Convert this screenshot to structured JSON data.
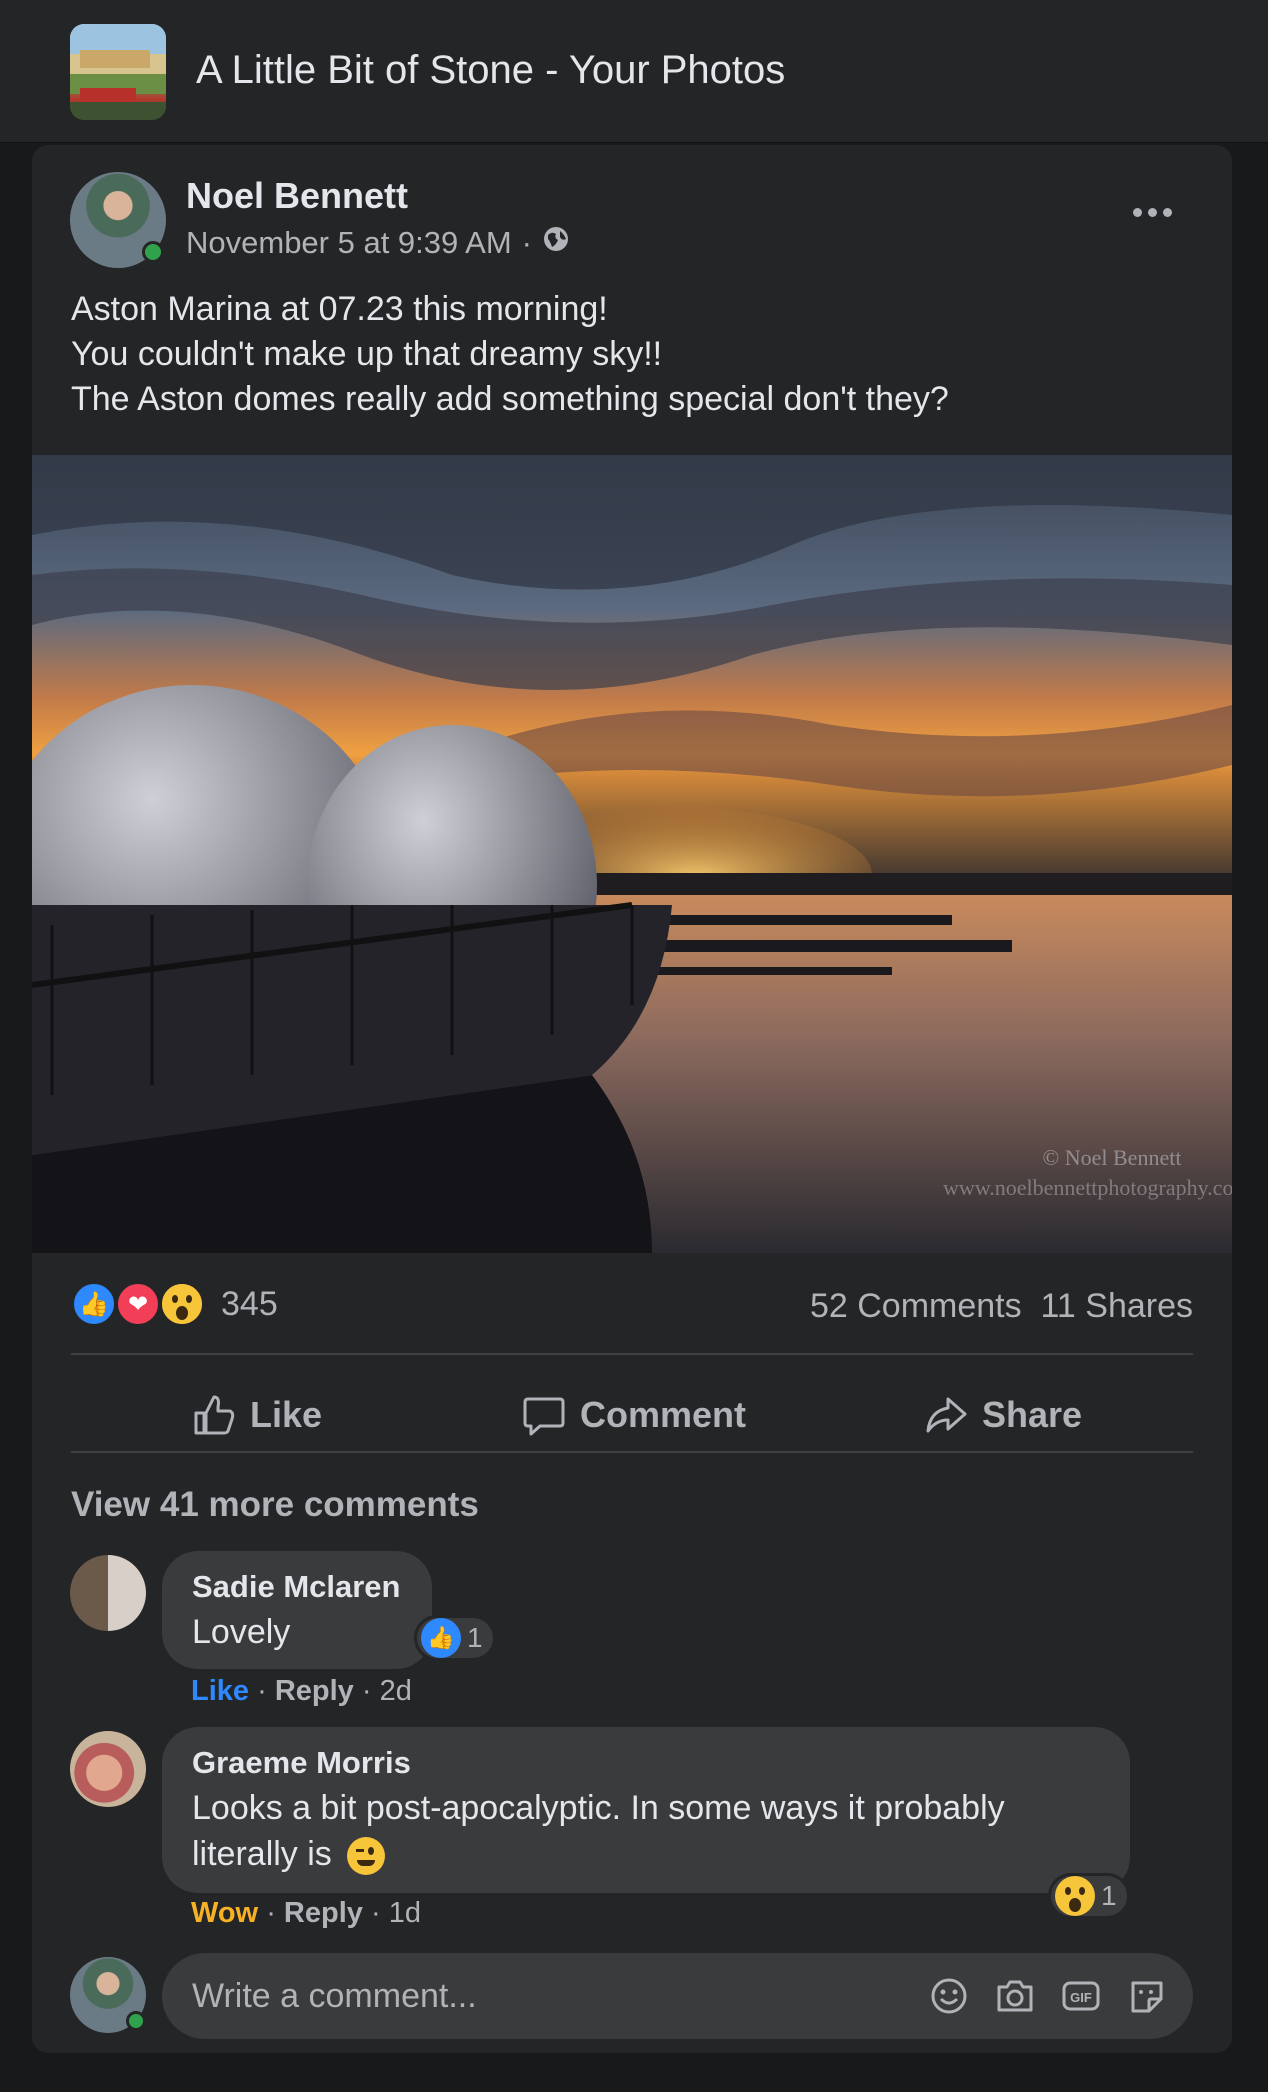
{
  "header": {
    "group_title": "A Little Bit of Stone - Your Photos"
  },
  "post": {
    "author": "Noel Bennett",
    "timestamp": "November 5 at 9:39 AM",
    "separator": "·",
    "text_lines": [
      "Aston Marina at 07.23 this morning!",
      "You couldn't make up that dreamy sky!!",
      "The Aston domes really add something special don't they?"
    ],
    "photo_watermark": [
      "© Noel Bennett",
      "www.noelbennettphotography.co.uk"
    ],
    "reaction_count": "345",
    "comments_count": "52 Comments",
    "shares_count": "11 Shares"
  },
  "actions": {
    "like": "Like",
    "comment": "Comment",
    "share": "Share"
  },
  "comments_section": {
    "view_more": "View 41 more comments",
    "comments": [
      {
        "name": "Sadie Mclaren",
        "text": "Lovely",
        "reaction_label": "Like",
        "reply": "Reply",
        "age": "2d",
        "reaction_count": "1",
        "dot": "·"
      },
      {
        "name": "Graeme Morris",
        "text_line1": "Looks a bit post-apocalyptic. In some ways it probably",
        "text_line2": "literally is",
        "reaction_label": "Wow",
        "reply": "Reply",
        "age": "1d",
        "reaction_count": "1",
        "dot": "·"
      }
    ],
    "composer_placeholder": "Write a comment..."
  },
  "colors": {
    "background": "#18191a",
    "card": "#242526",
    "bubble": "#3a3b3c",
    "text_primary": "#e4e6eb",
    "text_secondary": "#b0b3b8",
    "like_blue": "#2e89ff",
    "love_red": "#f33e58",
    "wow_yellow": "#f7b125",
    "online_green": "#31a24c"
  },
  "icons": [
    "globe-icon",
    "more-icon",
    "like-icon",
    "comment-icon",
    "share-icon",
    "smiley-icon",
    "camera-icon",
    "gif-icon",
    "sticker-icon"
  ]
}
